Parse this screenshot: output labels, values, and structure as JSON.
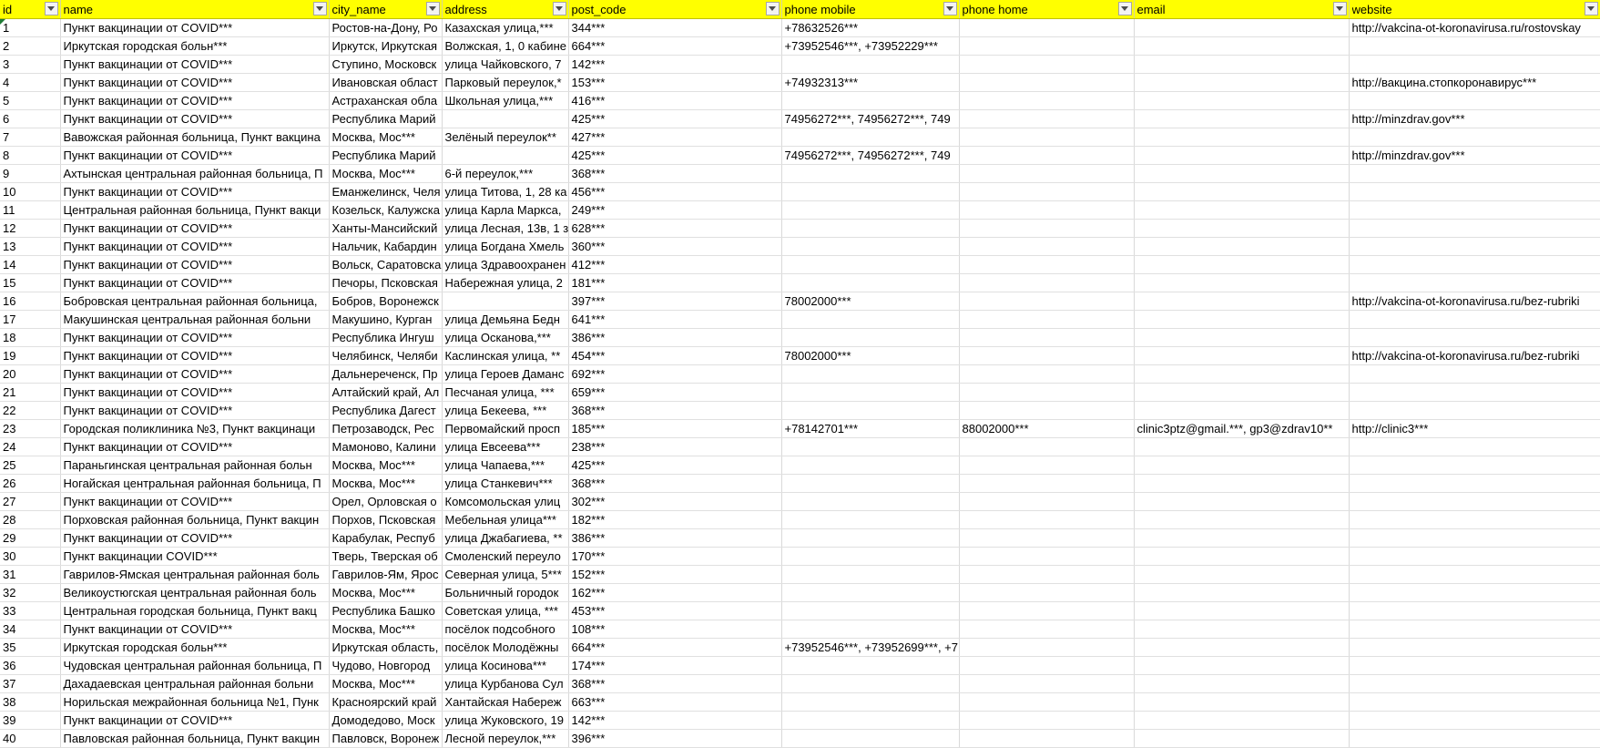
{
  "columns": [
    {
      "key": "id",
      "label": "id"
    },
    {
      "key": "name",
      "label": "name"
    },
    {
      "key": "city_name",
      "label": "city_name"
    },
    {
      "key": "address",
      "label": "address"
    },
    {
      "key": "post_code",
      "label": "post_code"
    },
    {
      "key": "phone_mobile",
      "label": "phone mobile"
    },
    {
      "key": "phone_home",
      "label": "phone home"
    },
    {
      "key": "email",
      "label": "email"
    },
    {
      "key": "website",
      "label": "website"
    }
  ],
  "rows": [
    [
      "1",
      "Пункт вакцинации от COVID***",
      "Ростов-на-Дону, Ро",
      "Казахская улица,***",
      "344***",
      "+78632526***",
      "",
      "",
      "http://vakcina-ot-koronavirusa.ru/rostovskay"
    ],
    [
      "2",
      "Иркутская городская больн***",
      "Иркутск, Иркутская",
      "Волжская, 1, 0 кабине",
      "664***",
      "+73952546***, +73952229***",
      "",
      "",
      ""
    ],
    [
      "3",
      "Пункт вакцинации от COVID***",
      "Ступино, Московск",
      "улица Чайковского, 7",
      "142***",
      "",
      "",
      "",
      ""
    ],
    [
      "4",
      "Пункт вакцинации от COVID***",
      "Ивановская област",
      "Парковый переулок,*",
      "153***",
      "+74932313***",
      "",
      "",
      "http://вакцина.стопкоронавирус***"
    ],
    [
      "5",
      "Пункт вакцинации от COVID***",
      "Астраханская обла",
      "Школьная улица,***",
      "416***",
      "",
      "",
      "",
      ""
    ],
    [
      "6",
      "Пункт вакцинации от COVID***",
      "Республика Марий",
      "",
      "425***",
      "74956272***, 74956272***, 749",
      "",
      "",
      "http://minzdrav.gov***"
    ],
    [
      "7",
      "Вавожская районная больница, Пункт вакцина",
      "Москва, Мос***",
      "Зелёный переулок**",
      "427***",
      "",
      "",
      "",
      ""
    ],
    [
      "8",
      "Пункт вакцинации от COVID***",
      "Республика Марий",
      "",
      "425***",
      "74956272***, 74956272***, 749",
      "",
      "",
      "http://minzdrav.gov***"
    ],
    [
      "9",
      "Ахтынская центральная районная больница, П",
      "Москва, Мос***",
      "6-й переулок,***",
      "368***",
      "",
      "",
      "",
      ""
    ],
    [
      "10",
      "Пункт вакцинации от COVID***",
      "Еманжелинск, Челя",
      "улица Титова, 1, 28 ка",
      "456***",
      "",
      "",
      "",
      ""
    ],
    [
      "11",
      "Центральная районная больница, Пункт вакци",
      "Козельск, Калужска",
      "улица Карла Маркса,",
      "249***",
      "",
      "",
      "",
      ""
    ],
    [
      "12",
      "Пункт вакцинации от COVID***",
      "Ханты-Мансийский",
      "улица Лесная, 13в, 1 з",
      "628***",
      "",
      "",
      "",
      ""
    ],
    [
      "13",
      "Пункт вакцинации от COVID***",
      "Нальчик, Кабардин",
      "улица Богдана Хмель",
      "360***",
      "",
      "",
      "",
      ""
    ],
    [
      "14",
      "Пункт вакцинации от COVID***",
      "Вольск, Саратовска",
      "улица Здравоохранен",
      "412***",
      "",
      "",
      "",
      ""
    ],
    [
      "15",
      "Пункт вакцинации от COVID***",
      "Печоры, Псковская",
      "Набережная улица, 2",
      "181***",
      "",
      "",
      "",
      ""
    ],
    [
      "16",
      "Бобровская центральная районная больница,",
      "Бобров, Воронежск",
      "",
      "397***",
      "78002000***",
      "",
      "",
      "http://vakcina-ot-koronavirusa.ru/bez-rubriki"
    ],
    [
      "17",
      "Макушинская центральная районная больни",
      "Макушино, Курган",
      "улица Демьяна Бедн",
      "641***",
      "",
      "",
      "",
      ""
    ],
    [
      "18",
      "Пункт вакцинации от COVID***",
      "Республика Ингуш",
      "улица Осканова,***",
      "386***",
      "",
      "",
      "",
      ""
    ],
    [
      "19",
      "Пункт вакцинации от COVID***",
      "Челябинск, Челяби",
      "Каслинская улица, **",
      "454***",
      "78002000***",
      "",
      "",
      "http://vakcina-ot-koronavirusa.ru/bez-rubriki"
    ],
    [
      "20",
      "Пункт вакцинации от COVID***",
      "Дальнереченск, Пр",
      "улица Героев Даманс",
      "692***",
      "",
      "",
      "",
      ""
    ],
    [
      "21",
      "Пункт вакцинации от COVID***",
      "Алтайский край, Ал",
      "Песчаная улица, ***",
      "659***",
      "",
      "",
      "",
      ""
    ],
    [
      "22",
      "Пункт вакцинации от COVID***",
      "Республика Дагест",
      "улица Бекеева, ***",
      "368***",
      "",
      "",
      "",
      ""
    ],
    [
      "23",
      "Городская поликлиника №3, Пункт вакцинаци",
      "Петрозаводск, Рес",
      "Первомайский просп",
      "185***",
      "+78142701***",
      "88002000***",
      "clinic3ptz@gmail.***, gp3@zdrav10**",
      "http://clinic3***"
    ],
    [
      "24",
      "Пункт вакцинации от COVID***",
      "Мамоново, Калини",
      "улица Евсеева***",
      "238***",
      "",
      "",
      "",
      ""
    ],
    [
      "25",
      "Параньгинская центральная районная больн",
      "Москва, Мос***",
      "улица Чапаева,***",
      "425***",
      "",
      "",
      "",
      ""
    ],
    [
      "26",
      "Ногайская центральная районная больница, П",
      "Москва, Мос***",
      "улица Станкевич***",
      "368***",
      "",
      "",
      "",
      ""
    ],
    [
      "27",
      "Пункт вакцинации от COVID***",
      "Орел, Орловская о",
      "Комсомольская улиц",
      "302***",
      "",
      "",
      "",
      ""
    ],
    [
      "28",
      "Порховская районная больница, Пункт вакцин",
      "Порхов, Псковская",
      "Мебельная улица***",
      "182***",
      "",
      "",
      "",
      ""
    ],
    [
      "29",
      "Пункт вакцинации от COVID***",
      "Карабулак, Респуб",
      "улица Джабагиева, **",
      "386***",
      "",
      "",
      "",
      ""
    ],
    [
      "30",
      "Пункт вакцинации COVID***",
      "Тверь, Тверская об",
      "Смоленский переуло",
      "170***",
      "",
      "",
      "",
      ""
    ],
    [
      "31",
      "Гаврилов-Ямская центральная районная боль",
      "Гаврилов-Ям, Ярос",
      "Северная улица, 5***",
      "152***",
      "",
      "",
      "",
      ""
    ],
    [
      "32",
      "Великоустюгская центральная районная боль",
      "Москва, Мос***",
      "Больничный городок",
      "162***",
      "",
      "",
      "",
      ""
    ],
    [
      "33",
      "Центральная городская больница, Пункт вакц",
      "Республика Башко",
      "Советская улица, ***",
      "453***",
      "",
      "",
      "",
      ""
    ],
    [
      "34",
      "Пункт вакцинации от COVID***",
      "Москва, Мос***",
      "посёлок подсобного",
      "108***",
      "",
      "",
      "",
      ""
    ],
    [
      "35",
      "Иркутская городская больн***",
      "Иркутская область,",
      "посёлок Молодёжны",
      "664***",
      "+73952546***, +73952699***, +7",
      "",
      "",
      ""
    ],
    [
      "36",
      "Чудовская центральная районная больница, П",
      "Чудово, Новгород",
      "улица Косинова***",
      "174***",
      "",
      "",
      "",
      ""
    ],
    [
      "37",
      "Дахадаевская центральная районная больни",
      "Москва, Мос***",
      "улица Курбанова Сул",
      "368***",
      "",
      "",
      "",
      ""
    ],
    [
      "38",
      "Норильская межрайонная больница №1, Пунк",
      "Красноярский край",
      "Хантайская Набереж",
      "663***",
      "",
      "",
      "",
      ""
    ],
    [
      "39",
      "Пункт вакцинации от COVID***",
      "Домодедово, Моск",
      "улица Жуковского, 19",
      "142***",
      "",
      "",
      "",
      ""
    ],
    [
      "40",
      "Павловская районная больница, Пункт вакцин",
      "Павловск, Воронеж",
      "Лесной переулок,***",
      "396***",
      "",
      "",
      "",
      ""
    ]
  ]
}
